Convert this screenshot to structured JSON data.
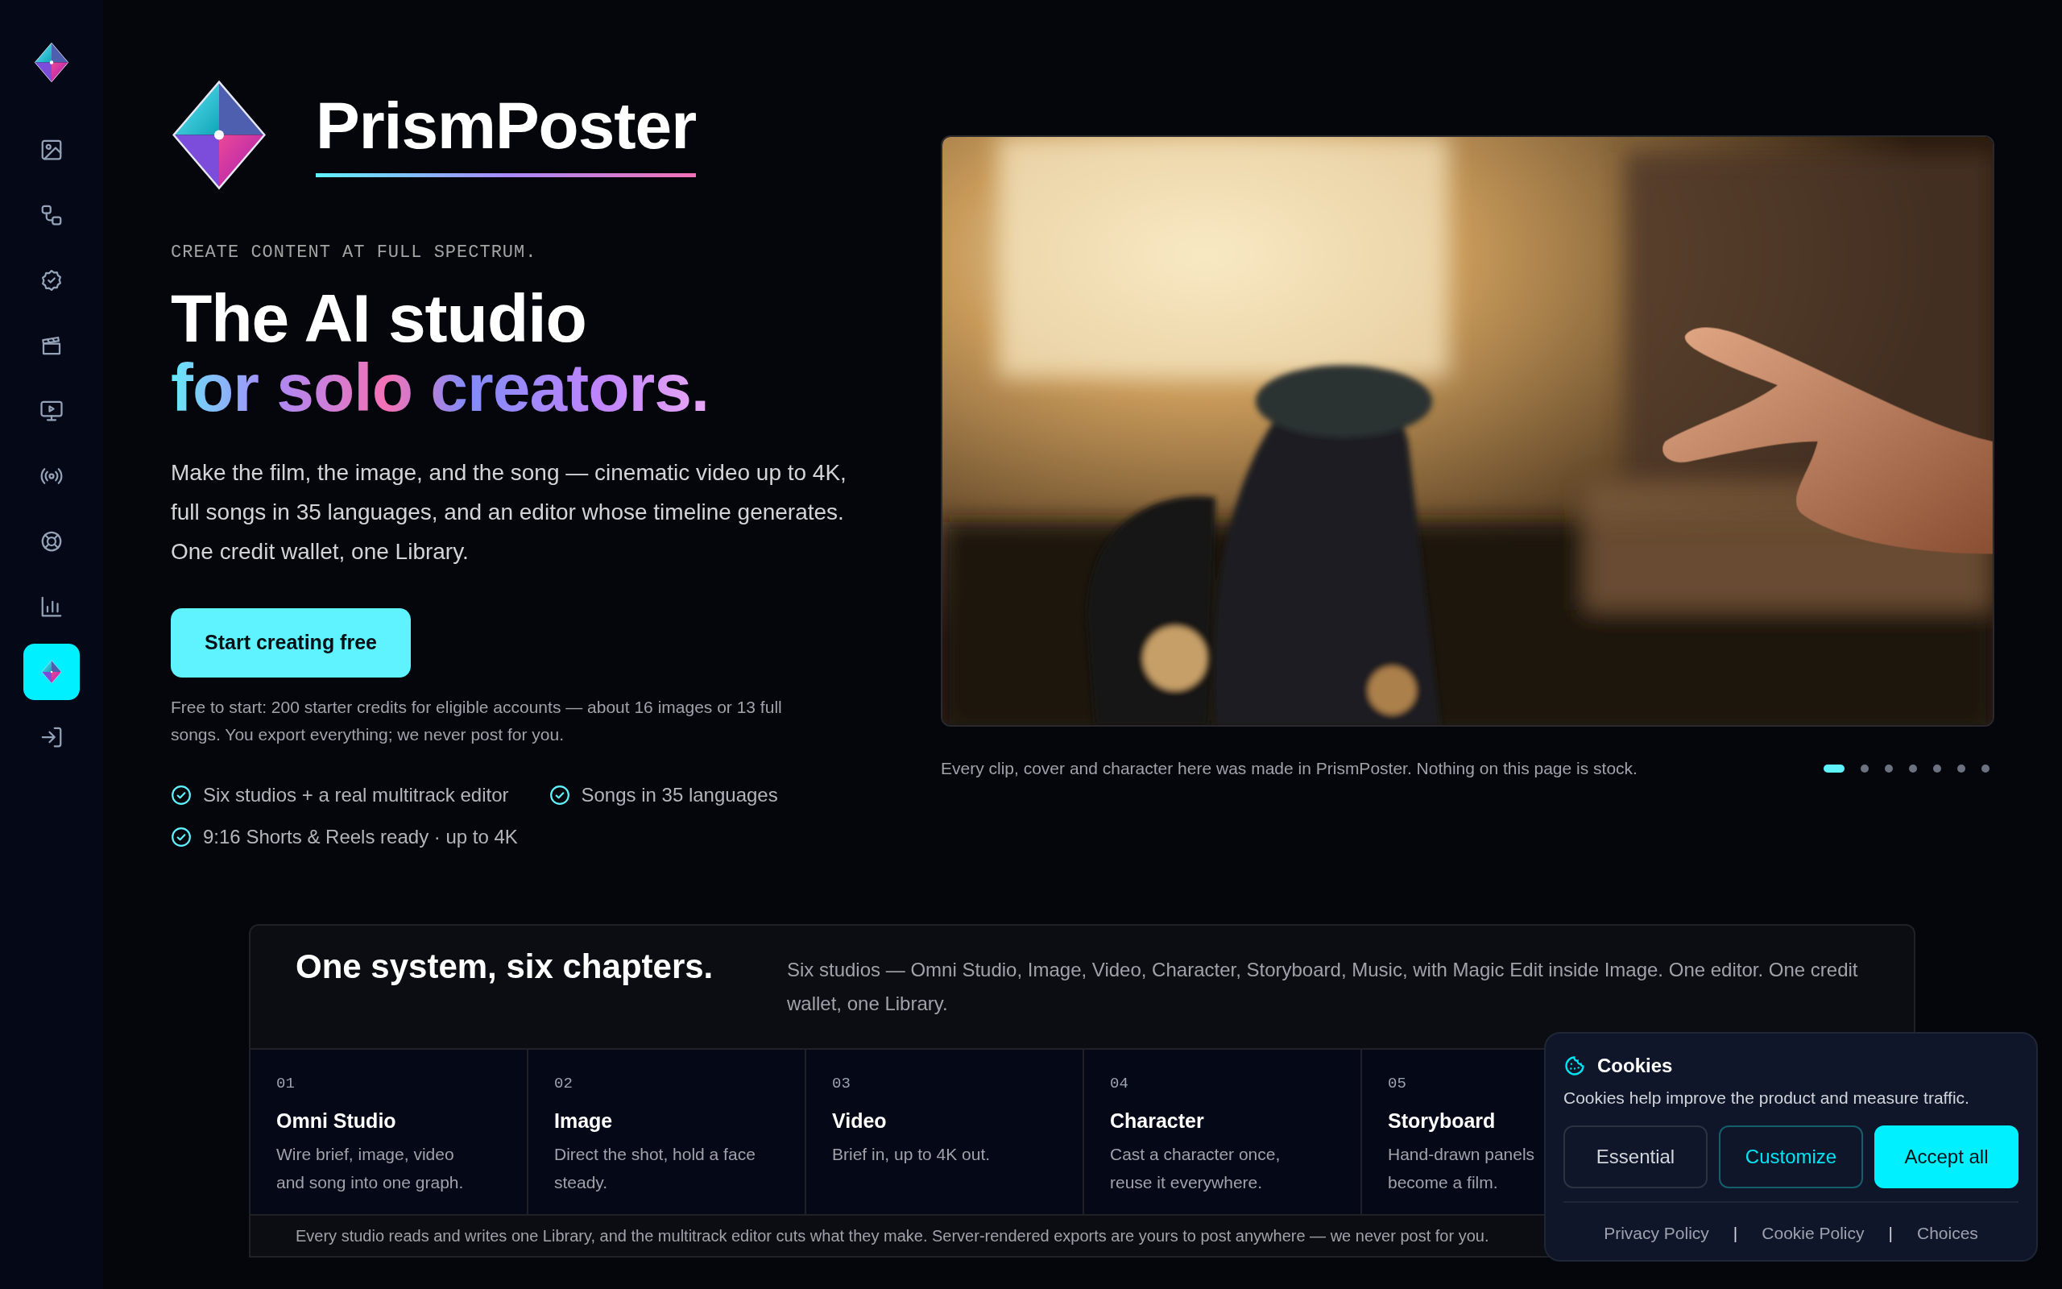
{
  "sidebar": {
    "items": [
      {
        "selected": false
      },
      {
        "selected": false
      },
      {
        "selected": false
      },
      {
        "selected": false
      },
      {
        "selected": false
      },
      {
        "selected": false
      },
      {
        "selected": false
      },
      {
        "selected": false
      },
      {
        "selected": true
      }
    ]
  },
  "hero": {
    "brand": "PrismPoster",
    "eyebrow": "CREATE CONTENT AT FULL SPECTRUM.",
    "headline_line1": "The AI studio",
    "headline_line2": "for solo creators.",
    "intro": "Make the film, the image, and the song — cinematic video up to 4K, full songs in 35 languages, and an editor whose timeline generates. One credit wallet, one Library.",
    "cta": "Start creating free",
    "note": "Free to start: 200 starter credits for eligible accounts — about 16 images or 13 full songs. You export everything; we never post for you.",
    "checks": [
      "Six studios + a real multitrack editor",
      "Songs in 35 languages",
      "9:16 Shorts & Reels ready · up to 4K"
    ]
  },
  "showcase": {
    "kind": "picture",
    "caption": "Every clip, cover and character here was made in PrismPoster. Nothing on this page is stock.",
    "dots": [
      {
        "selected": true
      },
      {
        "selected": false
      },
      {
        "selected": false
      },
      {
        "selected": false
      },
      {
        "selected": false
      },
      {
        "selected": false
      },
      {
        "selected": false
      }
    ]
  },
  "chapters": {
    "heading": "One system, six chapters.",
    "description": "Six studios — Omni Studio, Image, Video, Character, Storyboard, Music, with Magic Edit inside Image. One editor. One credit wallet, one Library.",
    "items": [
      {
        "number": "01",
        "title": "Omni Studio",
        "text": "Wire brief, image, video and song into one graph."
      },
      {
        "number": "02",
        "title": "Image",
        "text": "Direct the shot, hold a face steady."
      },
      {
        "number": "03",
        "title": "Video",
        "text": "Brief in, up to 4K out."
      },
      {
        "number": "04",
        "title": "Character",
        "text": "Cast a character once, reuse it everywhere."
      },
      {
        "number": "05",
        "title": "Storyboard",
        "text": "Hand-drawn panels become a film."
      }
    ],
    "footer": "Every studio reads and writes one Library, and the multitrack editor cuts what they make. Server-rendered exports are yours to post anywhere — we never post for you."
  },
  "cookies": {
    "title": "Cookies",
    "text": "Cookies help improve the product and measure traffic.",
    "buttons": [
      {
        "kind": "secondary",
        "label": "Essential"
      },
      {
        "kind": "outline",
        "label": "Customize"
      },
      {
        "kind": "primary",
        "label": "Accept all"
      }
    ],
    "footer": [
      {
        "kind": "link",
        "text": "Privacy Policy"
      },
      {
        "kind": "separator",
        "text": "|"
      },
      {
        "kind": "link",
        "text": "Cookie Policy"
      },
      {
        "kind": "separator",
        "text": "|"
      },
      {
        "kind": "link",
        "text": "Choices"
      }
    ]
  }
}
